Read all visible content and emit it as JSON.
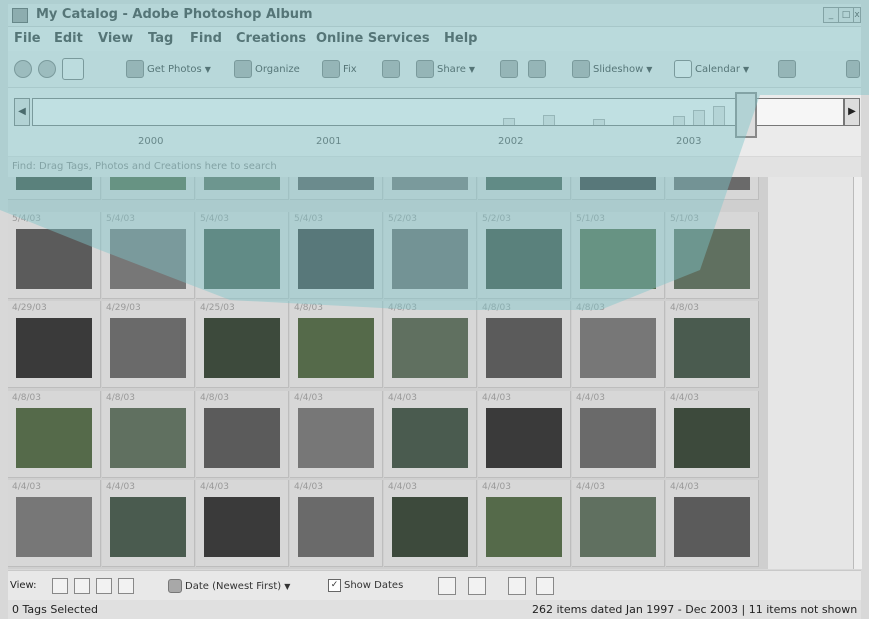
{
  "window": {
    "title": "My Catalog - Adobe Photoshop Album"
  },
  "menu": [
    "File",
    "Edit",
    "View",
    "Tag",
    "Find",
    "Creations",
    "Online Services",
    "Help"
  ],
  "toolbar": {
    "get_photos": "Get Photos",
    "organize": "Organize",
    "fix": "Fix",
    "share": "Share",
    "slideshow": "Slideshow",
    "calendar": "Calendar"
  },
  "timeline": {
    "years": [
      "2000",
      "2001",
      "2002",
      "2003"
    ]
  },
  "findbar": {
    "text": "Find: Drag Tags, Photos and Creations here to search"
  },
  "grid": {
    "rows": [
      {
        "dates": [
          "",
          "",
          "",
          "",
          "",
          "",
          "",
          ""
        ]
      },
      {
        "dates": [
          "5/4/03",
          "5/4/03",
          "5/4/03",
          "5/4/03",
          "5/2/03",
          "5/2/03",
          "5/1/03",
          "5/1/03"
        ]
      },
      {
        "dates": [
          "4/29/03",
          "4/29/03",
          "4/25/03",
          "4/8/03",
          "4/8/03",
          "4/8/03",
          "4/8/03",
          "4/8/03"
        ]
      },
      {
        "dates": [
          "4/8/03",
          "4/8/03",
          "4/8/03",
          "4/4/03",
          "4/4/03",
          "4/4/03",
          "4/4/03",
          "4/4/03"
        ]
      },
      {
        "dates": [
          "4/4/03",
          "4/4/03",
          "4/4/03",
          "4/4/03",
          "4/4/03",
          "4/4/03",
          "4/4/03",
          "4/4/03"
        ]
      }
    ]
  },
  "viewbar": {
    "view_label": "View:",
    "sort": "Date (Newest First)",
    "show_dates": "Show Dates"
  },
  "status": {
    "left": "0 Tags Selected",
    "right": "262 items dated Jan 1997 - Dec 2003  |  11 items not shown"
  },
  "colors": {
    "highlight": "#7fc6c9"
  }
}
